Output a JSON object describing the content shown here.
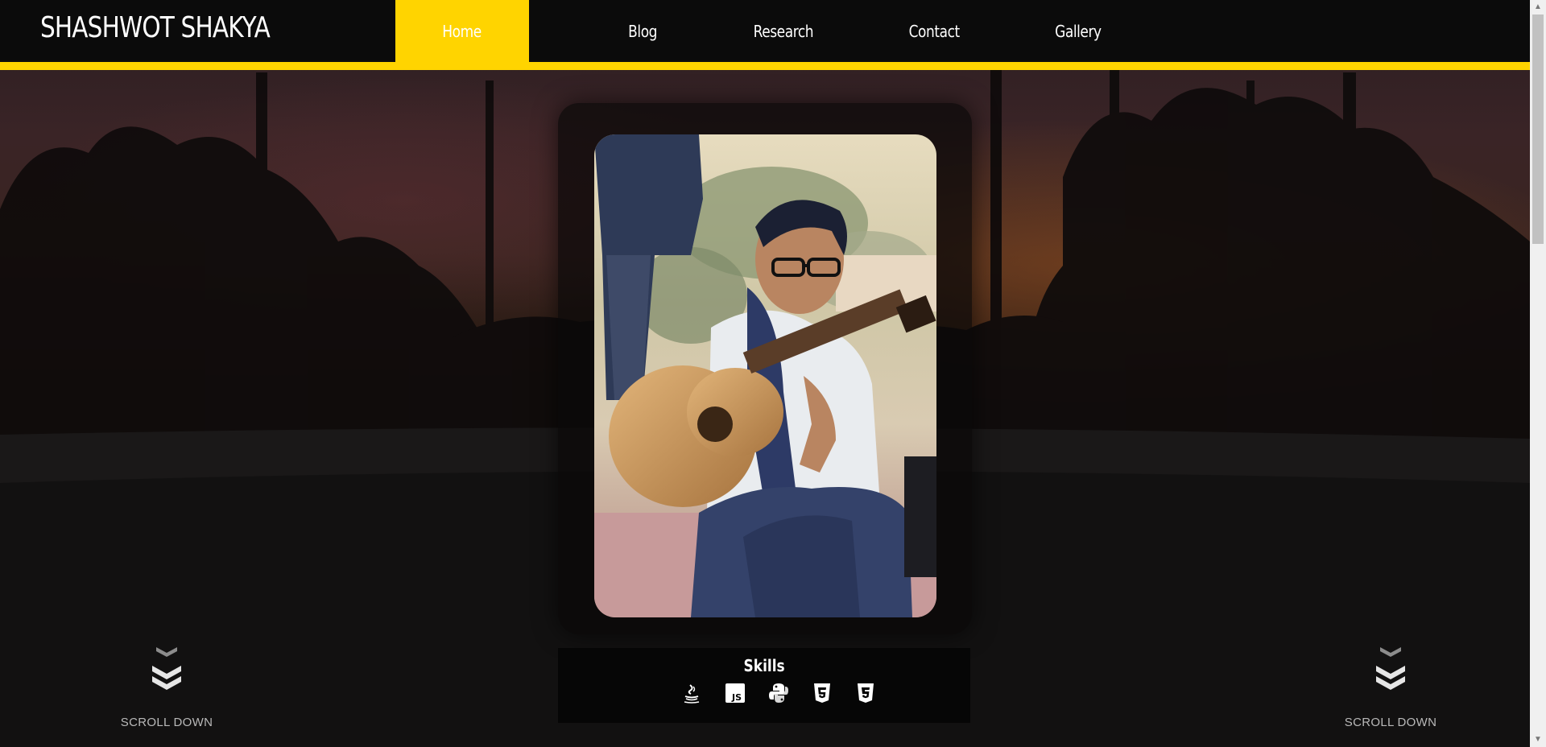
{
  "site": {
    "brand": "SHASHWOT SHAKYA"
  },
  "nav": {
    "items": [
      {
        "label": "Home",
        "active": true
      },
      {
        "label": "Blog",
        "active": false
      },
      {
        "label": "Research",
        "active": false
      },
      {
        "label": "Contact",
        "active": false
      },
      {
        "label": "Gallery",
        "active": false
      }
    ]
  },
  "skills": {
    "title": "Skills",
    "icons": [
      "java-icon",
      "javascript-icon",
      "python-icon",
      "html5-icon",
      "css3-icon"
    ]
  },
  "scroll": {
    "left_label": "SCROLL DOWN",
    "right_label": "SCROLL DOWN"
  },
  "colors": {
    "accent": "#ffd400",
    "header_bg": "#0b0b0b",
    "text": "#ffffff"
  }
}
